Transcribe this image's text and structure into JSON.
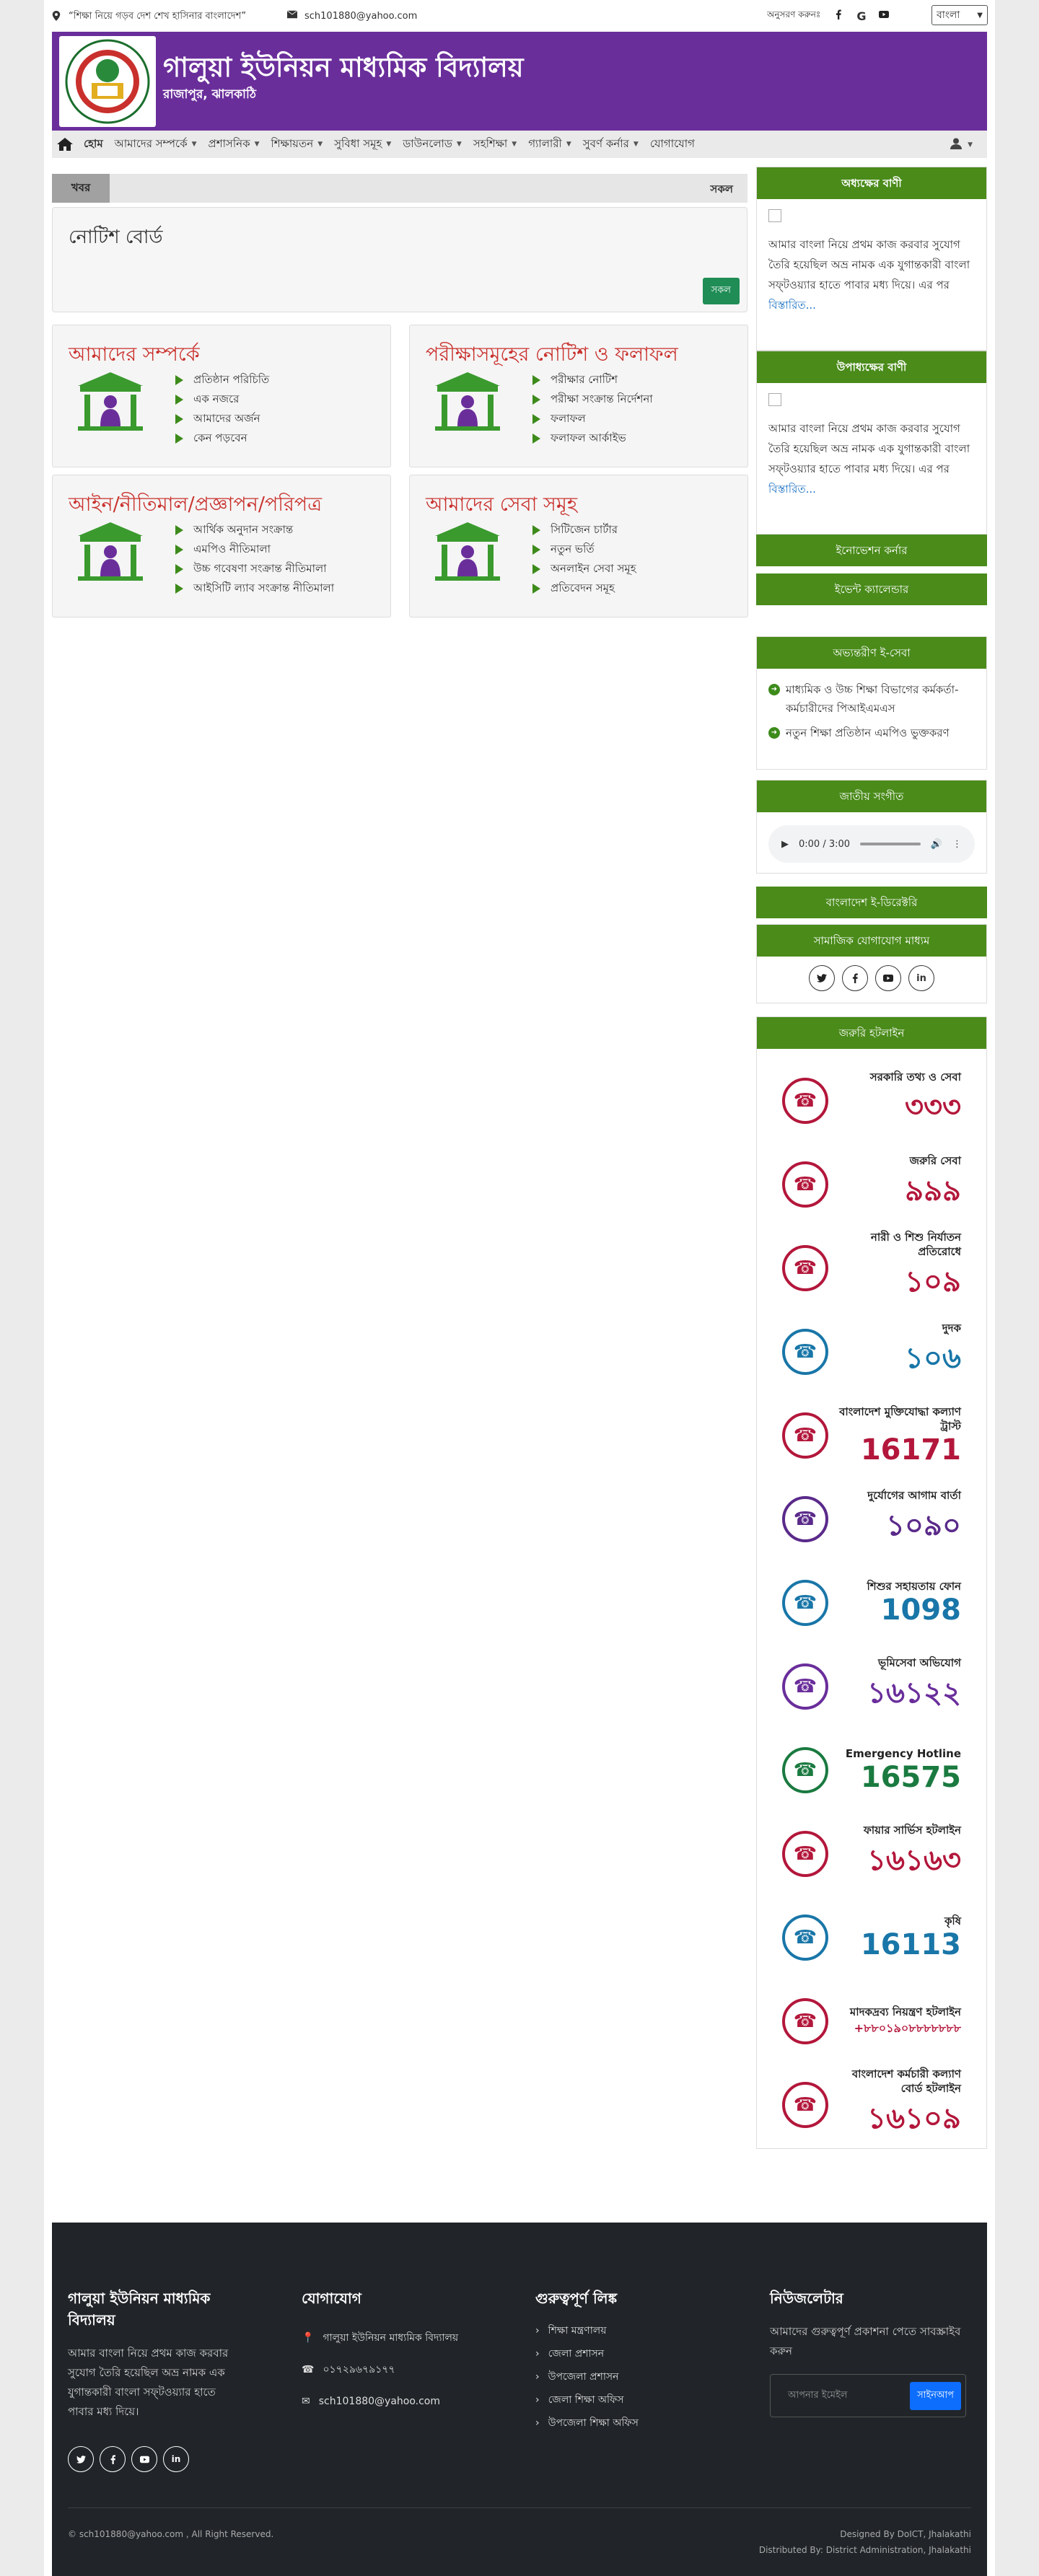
{
  "topbar": {
    "slogan": "“শিক্ষা নিয়ে গড়ব দেশ শেখ হাসিনার বাংলাদেশ”",
    "email": "sch101880@yahoo.com",
    "follow": "অনুসরণ করুনঃ",
    "language": "বাংলা"
  },
  "header": {
    "title": "গালুয়া ইউনিয়ন মাধ্যমিক বিদ্যালয়",
    "subtitle": "রাজাপুর, ঝালকাঠি"
  },
  "nav": {
    "items": [
      "হোম",
      "আমাদের সম্পর্কে",
      "প্রশাসনিক",
      "শিক্ষায়তন",
      "সুবিধা সমূহ",
      "ডাউনলোড",
      "সহশিক্ষা",
      "গ্যালারী",
      "সুবর্ণ কর্নার",
      "যোগাযোগ"
    ]
  },
  "ticker": {
    "label": "খবর",
    "all": "সকল"
  },
  "notice": {
    "title": "নোটিশ বোর্ড",
    "button": "সকল"
  },
  "cards": [
    {
      "title": "আমাদের সম্পর্কে",
      "items": [
        "প্রতিষ্ঠান পরিচিতি",
        "এক নজরে",
        "আমাদের অর্জন",
        "কেন পড়বেন"
      ]
    },
    {
      "title": "পরীক্ষাসমূহের নোটিশ ও ফলাফল",
      "items": [
        "পরীক্ষার নোটিশ",
        "পরীক্ষা সংক্রান্ত নির্দেশনা",
        "ফলাফল",
        "ফলাফল আর্কাইভ"
      ]
    },
    {
      "title": "আইন/নীতিমাল/প্রজ্ঞাপন/পরিপত্র",
      "items": [
        "আর্থিক অনুদান সংক্রান্ত",
        "এমপিও নীতিমালা",
        "উচ্চ গবেষণা সংক্রান্ত নীতিমালা",
        "আইসিটি ল্যাব সংক্রান্ত নীতিমালা"
      ]
    },
    {
      "title": "আমাদের সেবা সমূহ",
      "items": [
        "সিটিজেন চার্টার",
        "নতুন ভর্তি",
        "অনলাইন সেবা সমূহ",
        "প্রতিবেদন সমূহ"
      ]
    }
  ],
  "sidebar": {
    "chair_title": "অধ্যক্ষের বাণী",
    "chair_text": "আমার বাংলা নিয়ে প্রথম কাজ করবার সুযোগ তৈরি হয়েছিল অভ্র নামক এক যুগান্তকারী বাংলা সফ্‌টওয়্যার হাতে পাবার মধ্য দিয়ে। এর পর",
    "vice_title": "উপাধ্যক্ষের বাণী",
    "vice_text": "আমার বাংলা নিয়ে প্রথম কাজ করবার সুযোগ তৈরি হয়েছিল অভ্র নামক এক যুগান্তকারী বাংলা সফ্‌টওয়্যার হাতে পাবার মধ্য দিয়ে। এর পর",
    "more": "বিস্তারিত...",
    "innovation": "ইনোভেশন কর্নার",
    "event": "ইভেন্ট ক্যালেন্ডার",
    "eservice_title": "অভ্যন্তরীণ ই-সেবা",
    "eservice_items": [
      "মাধ্যমিক ও উচ্চ শিক্ষা বিভাগের কর্মকর্তা-কর্মচারীদের পিআইএমএস",
      "নতুন শিক্ষা প্রতিষ্ঠান এমপিও ভুক্তকরণ"
    ],
    "anthem": "জাতীয় সংগীত",
    "audio_time": "0:00 / 3:00",
    "directory": "বাংলাদেশ ই-ডিরেক্টরি",
    "social": "সামাজিক যোগাযোগ মাধ্যম",
    "hotline": "জরুরি হটলাইন",
    "hotlines": [
      {
        "label": "সরকারি তথ্য ও সেবা",
        "num": "৩৩৩"
      },
      {
        "label": "জরুরি সেবা",
        "num": "৯৯৯"
      },
      {
        "label": "নারী ও শিশু নির্যাতন প্রতিরোধে",
        "num": "১০৯"
      },
      {
        "label": "দুদক",
        "num": "১০৬"
      },
      {
        "label": "বাংলাদেশ মুক্তিযোদ্ধা কল্যাণ ট্রাস্ট",
        "num": "16171"
      },
      {
        "label": "দুর্যোগের আগাম বার্তা",
        "num": "১০৯০"
      },
      {
        "label": "শিশুর সহায়তায় ফোন",
        "num": "1098"
      },
      {
        "label": "ভূমিসেবা অভিযোগ",
        "num": "১৬১২২"
      },
      {
        "label": "Emergency Hotline",
        "num": "16575"
      },
      {
        "label": "ফায়ার সার্ভিস হটলাইন",
        "num": "১৬১৬৩"
      },
      {
        "label": "কৃষি",
        "num": "16113"
      },
      {
        "label": "মাদকদ্রব্য নিয়ন্ত্রণ হটলাইন",
        "num": "+৮৮০১৯০৮৮৮৮৮৮৮"
      },
      {
        "label": "বাংলাদেশ কর্মচারী কল্যাণ বোর্ড হটলাইন",
        "num": "১৬১০৯"
      }
    ]
  },
  "footer": {
    "school": "গালুয়া ইউনিয়ন মাধ্যমিক বিদ্যালয়",
    "about": "আমার বাংলা নিয়ে প্রথম কাজ করবার সুযোগ তৈরি হয়েছিল অভ্র নামক এক যুগান্তকারী বাংলা সফ্‌টওয়্যার হাতে পাবার মধ্য দিয়ে।",
    "contact_title": "যোগাযোগ",
    "address": "গালুয়া ইউনিয়ন মাধ্যমিক বিদ্যালয়",
    "phone": "০১৭২৯৬৭৯১৭৭",
    "email": "sch101880@yahoo.com",
    "links_title": "গুরুত্বপূর্ণ লিঙ্ক",
    "links": [
      "শিক্ষা মন্ত্রণালয়",
      "জেলা প্রশাসন",
      "উপজেলা প্রশাসন",
      "জেলা শিক্ষা অফিস",
      "উপজেলা শিক্ষা অফিস"
    ],
    "news_title": "নিউজলেটার",
    "news_text": "আমাদের গুরুত্বপূর্ণ প্রকাশনা পেতে সাবস্ক্রাইব করুন",
    "email_placeholder": "আপনার ইমেইল",
    "subscribe": "সাইনআপ",
    "copyright": "© sch101880@yahoo.com , All Right Reserved.",
    "designed": "Designed By DoICT, Jhalakathi",
    "distributed": "Distributed By: District Administration, Jhalakathi"
  }
}
